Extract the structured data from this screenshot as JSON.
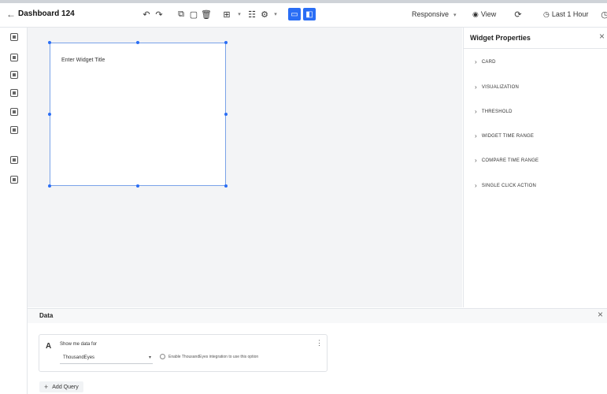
{
  "toolbar": {
    "back_icon": "arrow-left-icon",
    "title": "Dashboard 124",
    "responsive_label": "Responsive",
    "view_label": "View",
    "time_range_label": "Last 1 Hour"
  },
  "canvas": {
    "widget_title_placeholder": "Enter Widget Title"
  },
  "widget_properties": {
    "title": "Widget Properties",
    "sections": [
      {
        "label": "CARD"
      },
      {
        "label": "VISUALIZATION"
      },
      {
        "label": "THRESHOLD"
      },
      {
        "label": "WIDGET TIME RANGE"
      },
      {
        "label": "COMPARE TIME RANGE"
      },
      {
        "label": "SINGLE CLICK ACTION"
      }
    ]
  },
  "data_panel": {
    "title": "Data",
    "query": {
      "letter": "A",
      "show_me_label": "Show me data for",
      "source_value": "ThousandEyes",
      "option_label": "Enable ThousandEyes integration to use this option"
    },
    "add_query_label": "Add Query"
  },
  "colors": {
    "accent": "#2a6ef5",
    "canvas_bg": "#f3f4f6",
    "widget_border": "#7aa3e8"
  }
}
